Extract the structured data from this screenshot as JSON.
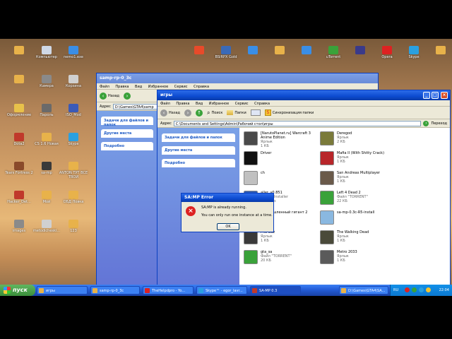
{
  "desktop_icons_left": [
    {
      "label": "",
      "color": "#e8b24a"
    },
    {
      "label": "Компьютер",
      "color": "#cfd8e6"
    },
    {
      "label": "nemo1.exe",
      "color": "#3a8ee6"
    },
    {
      "label": "",
      "color": "#e8b24a"
    },
    {
      "label": "Камера",
      "color": "#8a8a8a"
    },
    {
      "label": "Корзина",
      "color": "#d0d0d0"
    },
    {
      "label": "Оформление",
      "color": "#e8c14a"
    },
    {
      "label": "Пароль",
      "color": "#6a6a6a"
    },
    {
      "label": "ISO_Mod",
      "color": "#3a5ab8"
    },
    {
      "label": "Dota2",
      "color": "#c0392b"
    },
    {
      "label": "CS 1.6 Новая",
      "color": "#e8b24a"
    },
    {
      "label": "Skype",
      "color": "#2aa0e0"
    },
    {
      "label": "Tears Fortress 2",
      "color": "#8a4a2a"
    },
    {
      "label": "sa-mp",
      "color": "#3a3a3a"
    },
    {
      "label": "ANTON ТУТ ВСЕ ТВОИ",
      "color": "#e8b24a"
    },
    {
      "label": "Hacker_Det...",
      "color": "#c0392b"
    },
    {
      "label": "Мой",
      "color": "#e8b24a"
    },
    {
      "label": "ОБД Ловка",
      "color": "#e8b24a"
    },
    {
      "label": "images",
      "color": "#8a8a8a"
    },
    {
      "label": "metodicheski...",
      "color": "#d0d0d0"
    },
    {
      "label": "123",
      "color": "#e8b24a"
    }
  ],
  "desktop_icons_top": [
    {
      "label": "",
      "color": "#e84a2a"
    },
    {
      "label": "BSIRPX Gold",
      "color": "#3a6ab8"
    },
    {
      "label": "",
      "color": "#3a8ee6"
    },
    {
      "label": "",
      "color": "#e8b24a"
    },
    {
      "label": "",
      "color": "#3a8ee6"
    },
    {
      "label": "uTorrent",
      "color": "#3aa23a"
    },
    {
      "label": "",
      "color": "#3a3a8a"
    },
    {
      "label": "Opera",
      "color": "#d22"
    },
    {
      "label": "Skype",
      "color": "#2aa0e0"
    },
    {
      "label": "",
      "color": "#e8b24a"
    }
  ],
  "window_back": {
    "title": "samp-rp-0_3c",
    "menu": [
      "Файл",
      "Правка",
      "Вид",
      "Избранное",
      "Сервис",
      "Справка"
    ],
    "back_label": "Назад",
    "address_label": "Адрес",
    "address_value": "D:\\Games\\GTA4\\samp",
    "tasks": [
      "Задачи для файлов и папок",
      "Другие места",
      "Подробно"
    ]
  },
  "window_front": {
    "title": "игры",
    "menu": [
      "Файл",
      "Правка",
      "Вид",
      "Избранное",
      "Сервис",
      "Справка"
    ],
    "back_label": "Назад",
    "search_label": "Поиск",
    "folders_label": "Папки",
    "sync_label": "Синхронизация папки",
    "address_label": "Адрес",
    "address_value": "C:\\Documents and Settings\\Admin\\Рабочий стол\\игры",
    "go_label": "Переход",
    "tasks": [
      "Задачи для файлов и папок",
      "Другие места",
      "Подробно"
    ],
    "files": [
      {
        "name": "[NarutoPlanet.ru] Warcraft 3 Anime Edition",
        "sub": "Ярлык",
        "size": "1 КБ",
        "color": "#4a4a4a"
      },
      {
        "name": "Driver",
        "sub": "",
        "size": "",
        "color": "#111"
      },
      {
        "name": "ch",
        "sub": "",
        "size": "",
        "color": "#c0c0c0"
      },
      {
        "name": "aller_v0.851",
        "sub": "v0.851 Installer",
        "size": "Products",
        "color": "#2a5ab8"
      },
      {
        "name": "Промышленный гигант 2",
        "sub": "Ярлык",
        "size": "1 КБ",
        "color": "#8a6a4a"
      },
      {
        "name": "ProPBuz",
        "sub": "Ярлык",
        "size": "1 КБ",
        "color": "#3a3a3a"
      },
      {
        "name": "gta_sa",
        "sub": "Файл \"TORRENT\"",
        "size": "20 КБ",
        "color": "#3aa23a"
      },
      {
        "name": "Deregod",
        "sub": "Ярлык",
        "size": "2 КБ",
        "color": "#7a7a3a"
      },
      {
        "name": "Mafia II (With Shitty Crack)",
        "sub": "Ярлык",
        "size": "1 КБ",
        "color": "#b8262a"
      },
      {
        "name": "San Andreas Multiplayer",
        "sub": "Ярлык",
        "size": "1 КБ",
        "color": "#6a5a4a"
      },
      {
        "name": "Left 4 Dead 2",
        "sub": "Файл \"TORRENT\"",
        "size": "22 КБ",
        "color": "#3aa23a"
      },
      {
        "name": "sa-mp-0.3c-R5-install",
        "sub": "",
        "size": "",
        "color": "#8ab8e0"
      },
      {
        "name": "The Walking Dead",
        "sub": "Ярлык",
        "size": "1 КБ",
        "color": "#4a4a3a"
      },
      {
        "name": "Metro 2033",
        "sub": "Ярлык",
        "size": "1 КБ",
        "color": "#5a5a5a"
      }
    ]
  },
  "dialog": {
    "title": "SA:MP Error",
    "line1": "SA:MP is already running.",
    "line2": "You can only run one instance at a time.",
    "ok": "OK"
  },
  "taskbar": {
    "start": "пуск",
    "items": [
      {
        "label": "игры",
        "color": "#e8b24a"
      },
      {
        "label": "samp-rp-0_3c",
        "color": "#e8b24a"
      },
      {
        "label": "TheHelpdpro - Yo...",
        "color": "#d22"
      },
      {
        "label": "Skype™ - egor_lavr...",
        "color": "#2aa0e0"
      },
      {
        "label": "SA-MP 0.3",
        "color": "#c0392b"
      },
      {
        "label": "D:\\Games\\GTA4\\SA...",
        "color": "#e8b24a"
      }
    ],
    "lang": "RU",
    "clock": "22:04"
  }
}
